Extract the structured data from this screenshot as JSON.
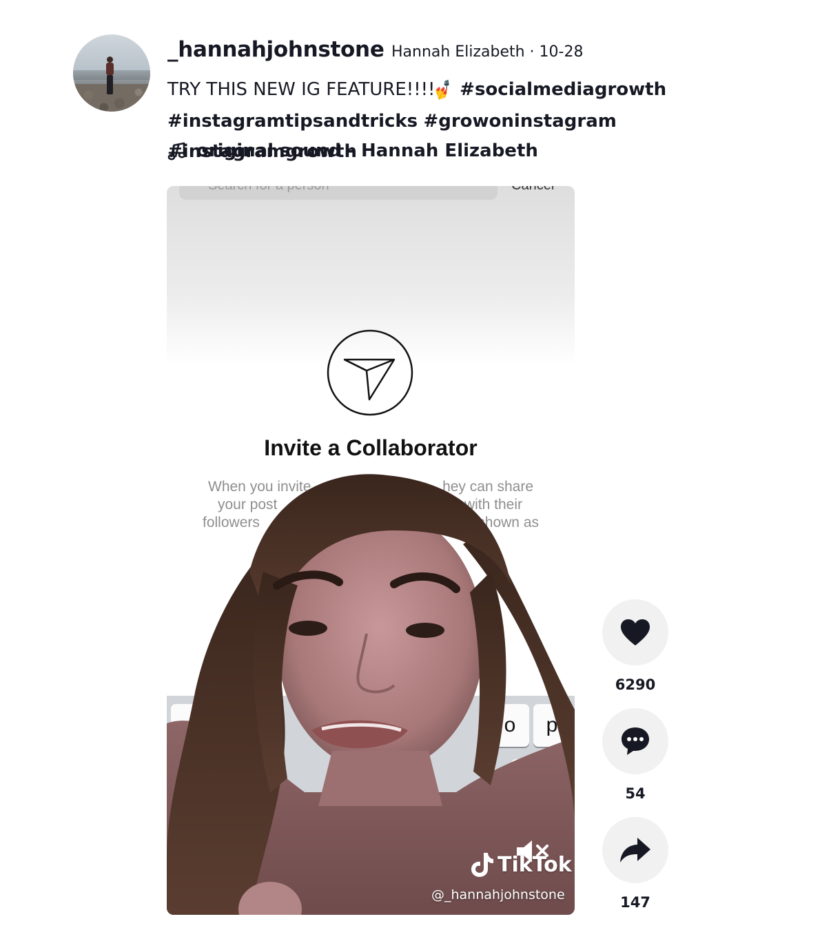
{
  "author": {
    "username": "_hannahjohnstone",
    "nickname_and_date": "Hannah Elizabeth · 10-28"
  },
  "caption": {
    "text": "TRY THIS NEW IG FEATURE!!!!",
    "emoji": "💅",
    "hashtags": [
      "#socialmediagrowth",
      "#instagramtipsandtricks",
      "#growoninstagram",
      "#instagramgrowth"
    ]
  },
  "sound": {
    "label": "original sound - Hannah Elizabeth",
    "icon": "music-note-icon"
  },
  "video": {
    "screen": {
      "search_placeholder": "Search for a person",
      "cancel_label": "Cancel",
      "title": "Invite a Collaborator",
      "description_visible": [
        "When you invite",
        "hey can share",
        "your post",
        "with their",
        "followers",
        "shown as"
      ],
      "keyboard_keys": [
        "o",
        "p"
      ]
    },
    "watermark_brand": "TikTok",
    "watermark_handle": "@_hannahjohnstone",
    "mute_icon": "muted-speaker-icon"
  },
  "actions": {
    "likes": "6290",
    "comments": "54",
    "shares": "147"
  },
  "colors": {
    "text": "#161823",
    "action_bg": "#f1f1f2"
  }
}
